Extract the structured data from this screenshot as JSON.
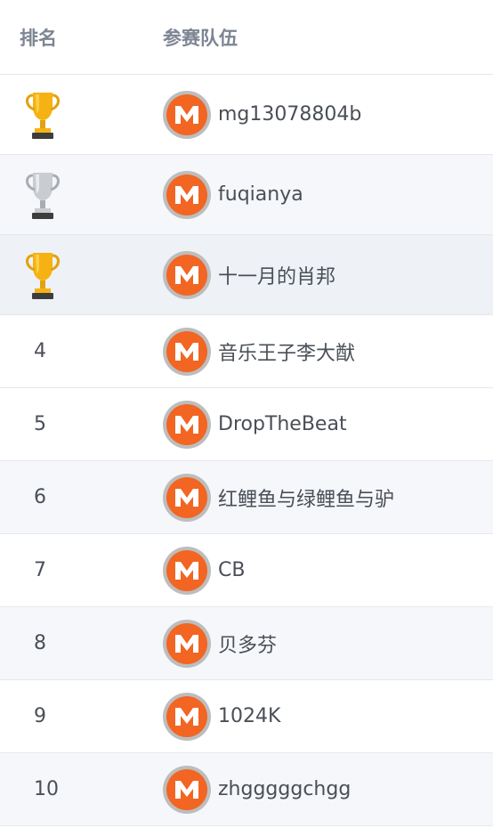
{
  "header": {
    "rank_label": "排名",
    "team_label": "参赛队伍"
  },
  "colors": {
    "gold": "#f5b212",
    "silver": "#c9ccd1",
    "brand": "#f26522"
  },
  "rows": [
    {
      "rank": "",
      "rank_icon": "gold-trophy-icon",
      "name": "mg13078804b"
    },
    {
      "rank": "",
      "rank_icon": "silver-trophy-icon",
      "name": "fuqianya"
    },
    {
      "rank": "",
      "rank_icon": "gold-trophy-icon",
      "name": "十一月的肖邦"
    },
    {
      "rank": "4",
      "name": "音乐王子李大猷"
    },
    {
      "rank": "5",
      "name": "DropTheBeat"
    },
    {
      "rank": "6",
      "name": "红鲤鱼与绿鲤鱼与驴"
    },
    {
      "rank": "7",
      "name": "CB"
    },
    {
      "rank": "8",
      "name": "贝多芬"
    },
    {
      "rank": "9",
      "name": "1024K"
    },
    {
      "rank": "10",
      "name": "zhgggggchgg"
    }
  ]
}
